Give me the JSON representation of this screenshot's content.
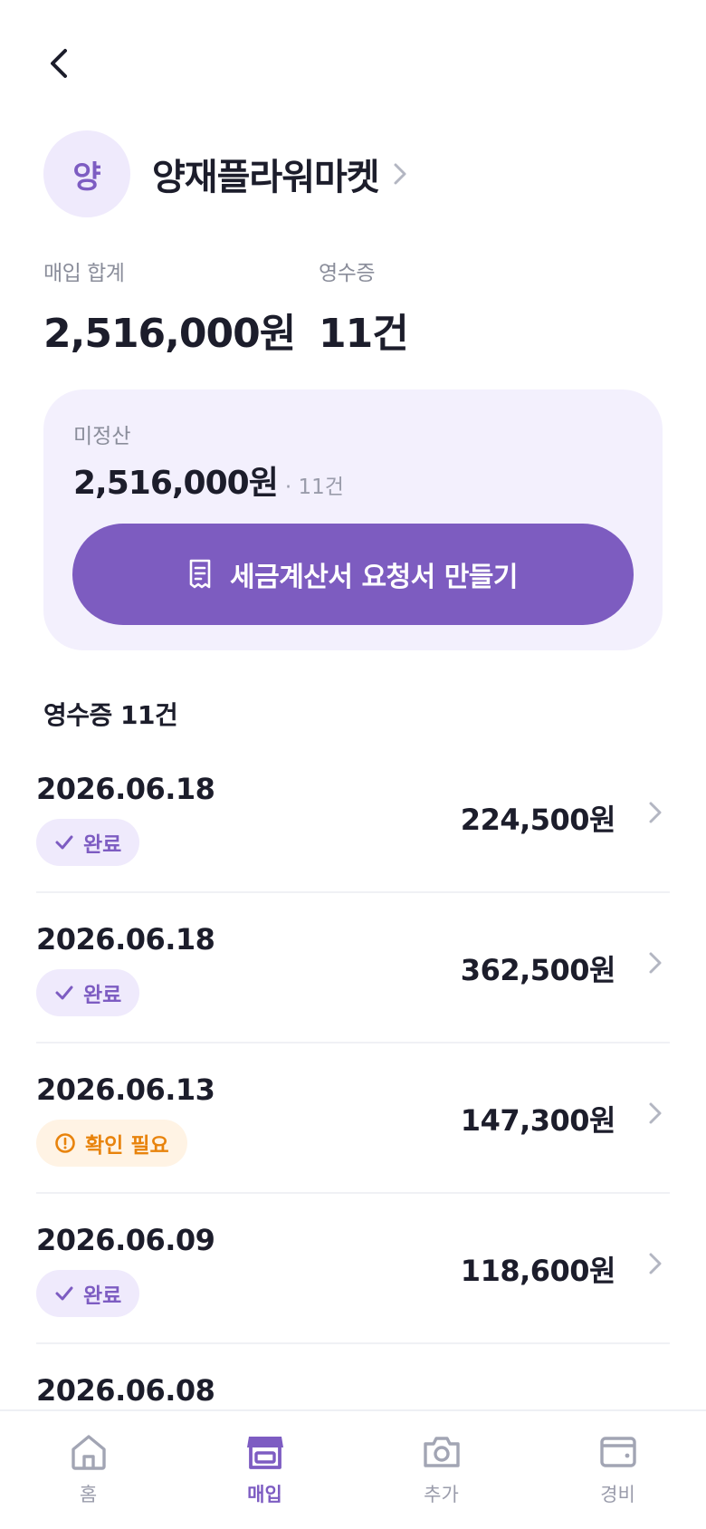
{
  "vendor": {
    "avatar_initial": "양",
    "name": "양재플라워마켓"
  },
  "summary": {
    "purchase_total_label": "매입 합계",
    "purchase_total_value": "2,516,000원",
    "receipt_label": "영수증",
    "receipt_value": "11건"
  },
  "unsettled": {
    "label": "미정산",
    "amount": "2,516,000원",
    "count": "· 11건",
    "cta_label": "세금계산서 요청서 만들기"
  },
  "receipts": {
    "section_title": "영수증 11건",
    "items": [
      {
        "date": "2026.06.18",
        "status": "완료",
        "status_type": "done",
        "amount": "224,500원"
      },
      {
        "date": "2026.06.18",
        "status": "완료",
        "status_type": "done",
        "amount": "362,500원"
      },
      {
        "date": "2026.06.13",
        "status": "확인 필요",
        "status_type": "warn",
        "amount": "147,300원"
      },
      {
        "date": "2026.06.09",
        "status": "완료",
        "status_type": "done",
        "amount": "118,600원"
      },
      {
        "date": "2026.06.08",
        "status": "",
        "status_type": "",
        "amount": ""
      }
    ]
  },
  "tabbar": {
    "tabs": [
      {
        "label": "홈",
        "icon": "home-icon"
      },
      {
        "label": "매입",
        "icon": "store-icon",
        "active": true
      },
      {
        "label": "추가",
        "icon": "camera-icon"
      },
      {
        "label": "경비",
        "icon": "wallet-icon"
      }
    ]
  },
  "colors": {
    "accent": "#7d5cc0",
    "accent_soft": "#efeafc",
    "warning": "#e8830c",
    "warning_soft": "#fff3e4",
    "text_primary": "#1c1d2b",
    "text_muted": "#8a8d9a"
  }
}
